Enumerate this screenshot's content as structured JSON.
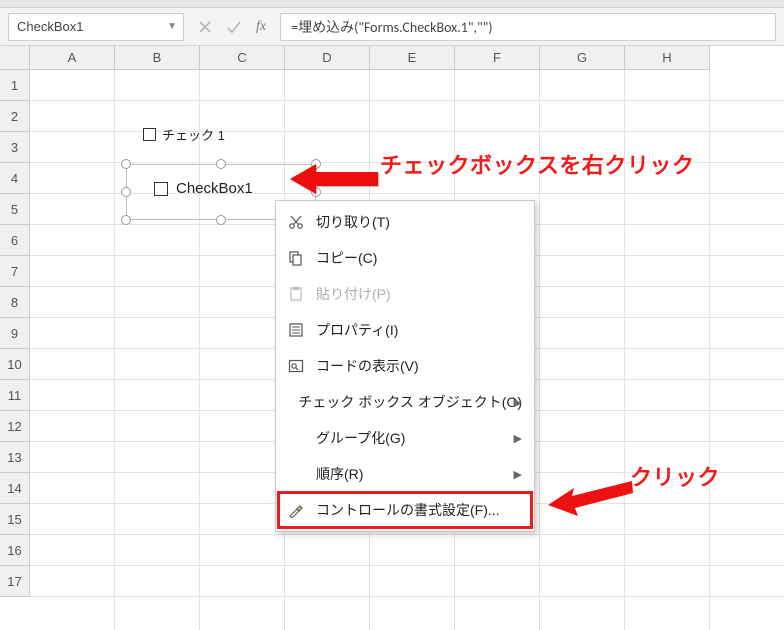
{
  "namebox": {
    "value": "CheckBox1"
  },
  "formula": {
    "value": "=埋め込み(\"Forms.CheckBox.1\",\"\")"
  },
  "columns": [
    "A",
    "B",
    "C",
    "D",
    "E",
    "F",
    "G",
    "H"
  ],
  "rows": [
    "1",
    "2",
    "3",
    "4",
    "5",
    "6",
    "7",
    "8",
    "9",
    "10",
    "11",
    "12",
    "13",
    "14",
    "15",
    "16",
    "17"
  ],
  "checkbox1": {
    "label": "チェック 1"
  },
  "selected_object": {
    "label": "CheckBox1"
  },
  "context_menu": {
    "items": {
      "cut": {
        "label": "切り取り(T)"
      },
      "copy": {
        "label": "コピー(C)"
      },
      "paste": {
        "label": "貼り付け(P)"
      },
      "props": {
        "label": "プロパティ(I)"
      },
      "viewcode": {
        "label": "コードの表示(V)"
      },
      "cbobject": {
        "label": "チェック ボックス オブジェクト(O)"
      },
      "group": {
        "label": "グループ化(G)"
      },
      "order": {
        "label": "順序(R)"
      },
      "formatctl": {
        "label": "コントロールの書式設定(F)..."
      }
    }
  },
  "annotations": {
    "rightclick": "チェックボックスを右クリック",
    "click": "クリック"
  }
}
